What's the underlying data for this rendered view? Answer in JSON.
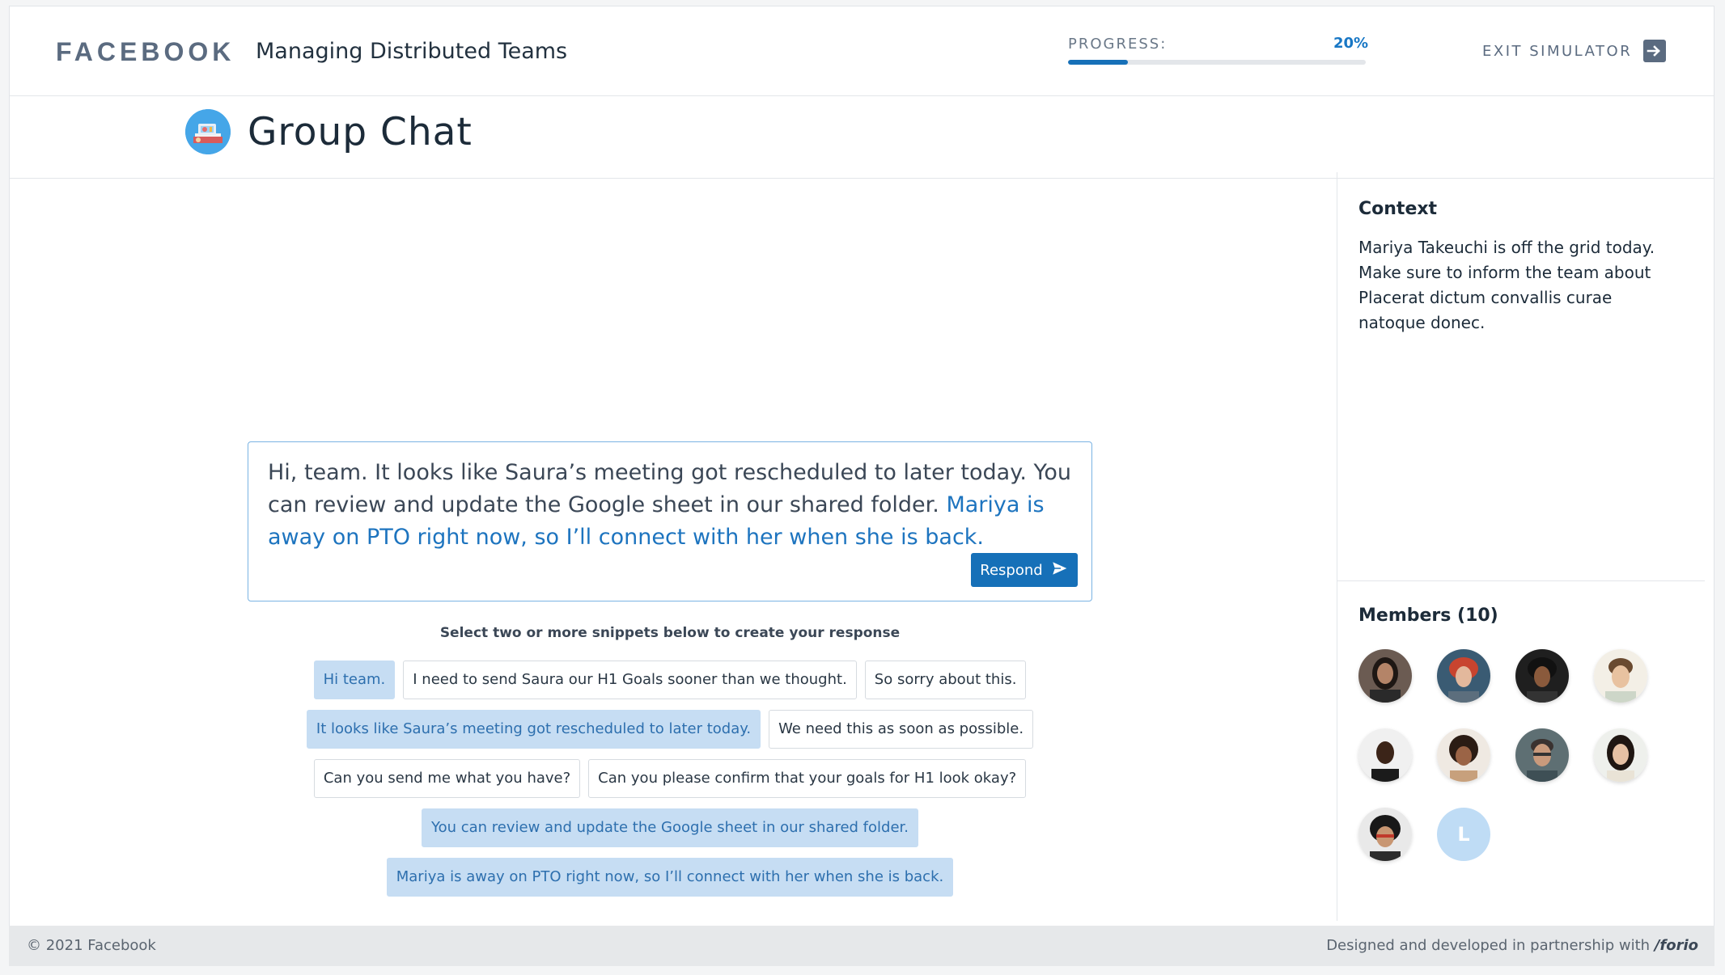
{
  "header": {
    "brand": "FACEBOOK",
    "course_title": "Managing Distributed Teams",
    "progress_label": "PROGRESS:",
    "progress_value": "20%",
    "progress_fraction": 0.2,
    "exit_label": "EXIT SIMULATOR",
    "exit_icon": "arrow-right-box-icon"
  },
  "page": {
    "title": "Group Chat",
    "icon": "group-chat-illustration-icon"
  },
  "response": {
    "text_plain": "Hi, team. It looks like Saura’s meeting got rescheduled to later today. You can review and update the Google sheet in our shared folder. ",
    "text_highlight": "Mariya is away on PTO right now, so I’ll connect with her when she is back.",
    "button_label": "Respond",
    "button_icon": "send-icon"
  },
  "instruction": "Select two or more snippets below to create your response",
  "snippet_rows": [
    [
      {
        "label": "Hi team.",
        "selected": true
      },
      {
        "label": "I need to send Saura our H1 Goals sooner than we thought.",
        "selected": false
      },
      {
        "label": "So sorry about this.",
        "selected": false
      }
    ],
    [
      {
        "label": "It looks like Saura’s meeting got rescheduled to later today.",
        "selected": true
      },
      {
        "label": "We need this as soon as possible.",
        "selected": false
      }
    ],
    [
      {
        "label": "Can you send me what you have?",
        "selected": false
      },
      {
        "label": "Can you please confirm that your goals for H1 look okay?",
        "selected": false
      }
    ],
    [
      {
        "label": "You can review and update the Google sheet in our shared folder.",
        "selected": true
      }
    ],
    [
      {
        "label": "Mariya is away on PTO right now, so I’ll connect with her when she is back.",
        "selected": true
      }
    ]
  ],
  "context": {
    "title": "Context",
    "text": "Mariya  Takeuchi is off the grid today. Make sure to inform the team about Placerat dictum convallis curae natoque donec."
  },
  "members": {
    "title": "Members (10)",
    "placeholder_initial": "L"
  },
  "footer": {
    "copyright": "© 2021 Facebook",
    "credit_prefix": "Designed and developed in partnership with ",
    "credit_brand": "/forio"
  },
  "colors": {
    "accent": "#1670b8",
    "selected_snippet_bg": "#c6ddf3",
    "highlight_text": "#1d74bf"
  }
}
